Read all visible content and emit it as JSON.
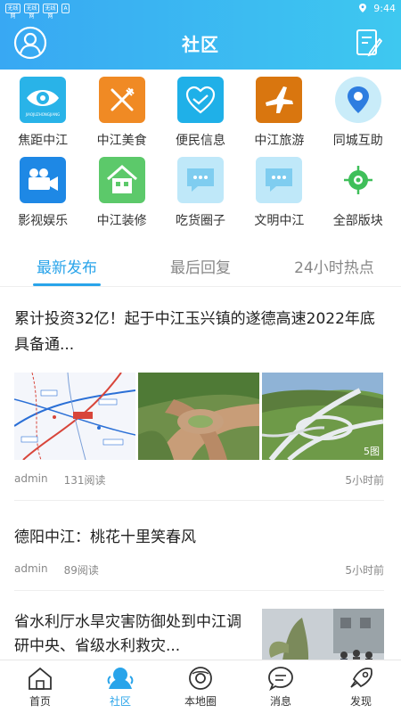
{
  "status_bar": {
    "left_icons": [
      "无线网",
      "无线网",
      "无线网",
      "A"
    ],
    "time": "9:44"
  },
  "header": {
    "title": "社区"
  },
  "categories": [
    {
      "label": "焦距中江",
      "icon": "eye-icon",
      "color": "#29b3e8",
      "sublabel": "JIAOJUZHONGJIANG"
    },
    {
      "label": "中江美食",
      "icon": "fork-knife-icon",
      "color": "#f08a24"
    },
    {
      "label": "便民信息",
      "icon": "handshake-heart-icon",
      "color": "#1fb0e8"
    },
    {
      "label": "中江旅游",
      "icon": "airplane-icon",
      "color": "#e07a10"
    },
    {
      "label": "同城互助",
      "icon": "location-pin-icon",
      "color": "#c9ecf9"
    },
    {
      "label": "影视娱乐",
      "icon": "video-camera-icon",
      "color": "#1e88e5"
    },
    {
      "label": "中江装修",
      "icon": "house-icon",
      "color": "#5cc96a"
    },
    {
      "label": "吃货圈子",
      "icon": "chat-bubble-icon",
      "color": "#bfe8f9"
    },
    {
      "label": "文明中江",
      "icon": "chat-bubble-icon",
      "color": "#bfe8f9"
    },
    {
      "label": "全部版块",
      "icon": "target-icon",
      "color": "#3fbf5a"
    }
  ],
  "tabs": [
    "最新发布",
    "最后回复",
    "24小时热点"
  ],
  "active_tab": "最新发布",
  "posts": [
    {
      "title": "累计投资32亿！起于中江玉兴镇的遂德高速2022年底具备通...",
      "author": "admin",
      "reads": "131阅读",
      "time": "5小时前",
      "image_count": "5图"
    },
    {
      "title": "德阳中江：桃花十里笑春风",
      "author": "admin",
      "reads": "89阅读",
      "time": "5小时前"
    },
    {
      "title": "省水利厅水旱灾害防御处到中江调研中央、省级水利救灾..."
    }
  ],
  "bottom_nav": [
    {
      "label": "首页",
      "icon": "home-icon"
    },
    {
      "label": "社区",
      "icon": "community-icon"
    },
    {
      "label": "本地圈",
      "icon": "local-circle-icon"
    },
    {
      "label": "消息",
      "icon": "message-icon"
    },
    {
      "label": "发现",
      "icon": "rocket-icon"
    }
  ],
  "colors": {
    "accent": "#29a4ea",
    "header_gradient_start": "#38a8f3",
    "header_gradient_end": "#3ec8f0"
  }
}
